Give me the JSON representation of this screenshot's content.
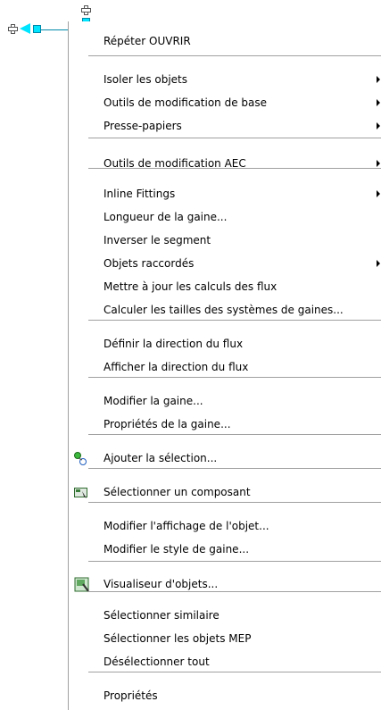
{
  "menu": {
    "items": [
      {
        "label": "Répéter OUVRIR",
        "submenu": false
      },
      {
        "label": "Isoler les objets",
        "submenu": true
      },
      {
        "label": "Outils de modification de base",
        "submenu": true
      },
      {
        "label": "Presse-papiers",
        "submenu": true
      },
      {
        "label": "Outils de modification AEC",
        "submenu": true
      },
      {
        "label": "Inline Fittings",
        "submenu": true
      },
      {
        "label": "Longueur de la gaine...",
        "submenu": false
      },
      {
        "label": "Inverser le segment",
        "submenu": false
      },
      {
        "label": "Objets raccordés",
        "submenu": true
      },
      {
        "label": "Mettre à jour les calculs des flux",
        "submenu": false
      },
      {
        "label": "Calculer les tailles des systèmes de gaines...",
        "submenu": false
      },
      {
        "label": "Définir la direction du flux",
        "submenu": false
      },
      {
        "label": "Afficher la direction du flux",
        "submenu": false
      },
      {
        "label": "Modifier la gaine...",
        "submenu": false
      },
      {
        "label": "Propriétés de la gaine...",
        "submenu": false
      },
      {
        "label": "Ajouter la sélection...",
        "submenu": false,
        "icon": "add-selection-icon"
      },
      {
        "label": "Sélectionner un composant",
        "submenu": false,
        "icon": "select-component-icon"
      },
      {
        "label": "Modifier l'affichage de l'objet...",
        "submenu": false
      },
      {
        "label": "Modifier le style de gaine...",
        "submenu": false
      },
      {
        "label": "Visualiseur d'objets...",
        "submenu": false,
        "icon": "object-viewer-icon"
      },
      {
        "label": "Sélectionner similaire",
        "submenu": false
      },
      {
        "label": "Sélectionner les objets MEP",
        "submenu": false
      },
      {
        "label": "Désélectionner tout",
        "submenu": false
      },
      {
        "label": "Propriétés",
        "submenu": false
      }
    ]
  },
  "colors": {
    "grip": "#00e5ff",
    "separator": "#a0a0a0"
  }
}
